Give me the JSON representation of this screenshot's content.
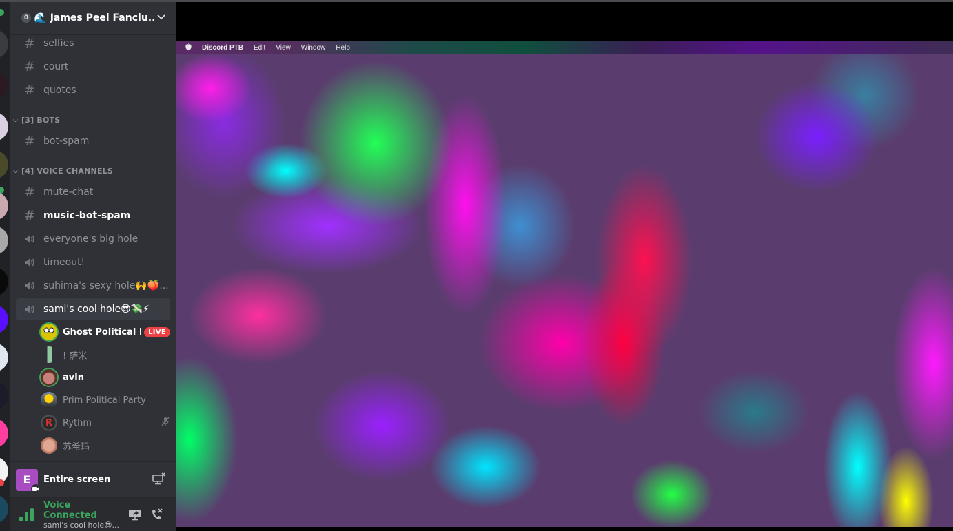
{
  "server": {
    "name": "James Peel Fanclu...",
    "boost_level": "0",
    "banner_emoji": "🌊"
  },
  "channels": [
    {
      "type": "text",
      "name": "selfies"
    },
    {
      "type": "text",
      "name": "court"
    },
    {
      "type": "text",
      "name": "quotes"
    }
  ],
  "categories": [
    {
      "label": "[3] BOTS",
      "channels": [
        {
          "type": "text",
          "name": "bot-spam"
        }
      ]
    },
    {
      "label": "[4] VOICE CHANNELS",
      "channels": [
        {
          "type": "text",
          "name": "mute-chat"
        },
        {
          "type": "text",
          "name": "music-bot-spam",
          "unread": true
        },
        {
          "type": "voice",
          "name": "everyone's big hole"
        },
        {
          "type": "voice",
          "name": "timeout!"
        },
        {
          "type": "voice",
          "name": "suhima's sexy hole🙌🍑..."
        },
        {
          "type": "voice",
          "name": "sami's cool hole😎💸⚡",
          "selected": true
        }
      ]
    }
  ],
  "voice_users": [
    {
      "name": "Ghost Political P...",
      "speaking": true,
      "live": true,
      "badge": "LIVE"
    },
    {
      "name": "! 萨米",
      "speaking": false
    },
    {
      "name": "avin",
      "speaking": true
    },
    {
      "name": "Prim Political Party",
      "speaking": false
    },
    {
      "name": "Rythm",
      "speaking": false,
      "muted_icon": "mic-off-icon"
    },
    {
      "name": "苏希玛",
      "speaking": false
    }
  ],
  "stream_panel": {
    "thumb_letter": "E",
    "label": "Entire screen"
  },
  "voice_panel": {
    "status": "Voice Connected",
    "channel": "sami's cool hole😎..."
  },
  "stream_view": {
    "mac_menu": {
      "apple": "",
      "items": [
        "Discord PTB",
        "Edit",
        "View",
        "Window",
        "Help"
      ]
    }
  },
  "colors": {
    "sidebar_bg": "#2f3136",
    "rail_bg": "#202225",
    "voice_green": "#3ba55d",
    "live_red": "#ed4245",
    "stream_thumb": "#a84cc1"
  }
}
